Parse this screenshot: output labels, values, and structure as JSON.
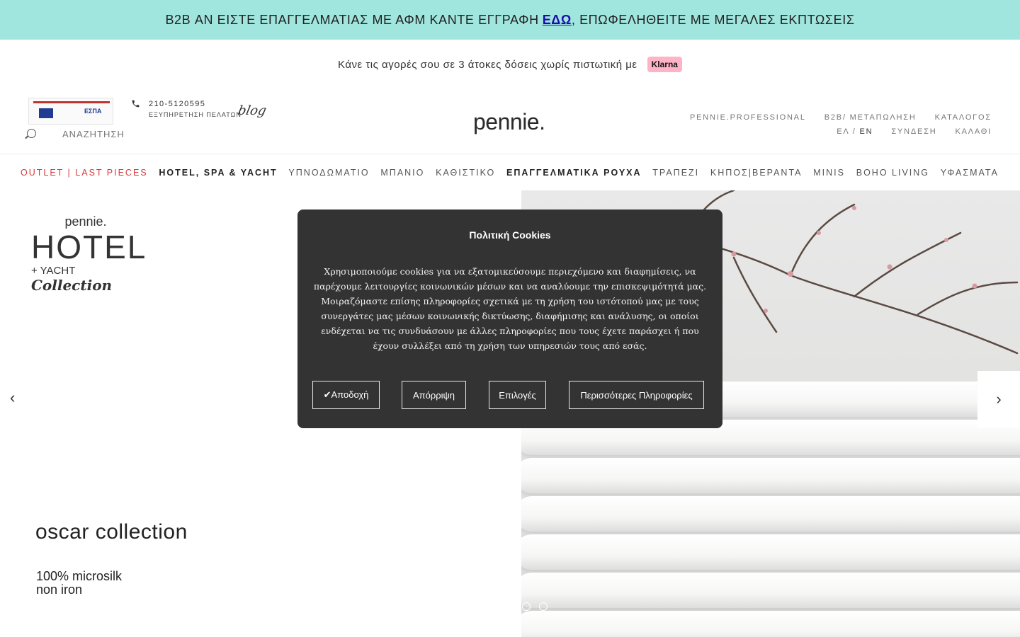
{
  "topbar": {
    "text_before": "B2B ΑΝ ΕΙΣΤΕ ΕΠΑΓΓΕΛΜΑΤΙΑΣ ΜΕ ΑΦΜ ΚΑΝΤΕ ΕΓΓΡΑΦΗ ",
    "link": "ΕΔΩ",
    "text_after": ", ΕΠΩΦΕΛΗΘΕΙΤΕ ΜΕ ΜΕΓΑΛΕΣ ΕΚΠΤΩΣΕΙΣ",
    "bg_color": "#a0e6de"
  },
  "klarna": {
    "text": "Κάνε τις αγορές σου σε 3 άτοκες δόσεις χωρίς πιστωτική με",
    "badge": "Klarna"
  },
  "header": {
    "espa_text": "ΕΣΠΑ",
    "phone": "210-5120595",
    "phone_sub": "ΕΞΥΠΗΡΕΤΗΣΗ ΠΕΛΑΤΩΝ",
    "blog": "blog",
    "search_placeholder": "ΑΝΑΖΗΤΗΣΗ",
    "logo": "pennie.",
    "right_row1": [
      "PENNIE.PROFESSIONAL",
      "B2B/ ΜΕΤΑΠΩΛΗΣΗ",
      "ΚΑΤΑΛΟΓΟΣ"
    ],
    "lang_el": "ΕΛ",
    "lang_sep": "/",
    "lang_en": "EN",
    "login": "ΣΥΝΔΕΣΗ",
    "cart": "ΚΑΛΑΘΙ"
  },
  "nav": [
    {
      "label": "OUTLET | LAST PIECES"
    },
    {
      "label": "HOTEL, SPA & YACHT"
    },
    {
      "label": "ΥΠΝΟΔΩΜΑΤΙΟ"
    },
    {
      "label": "ΜΠΑΝΙΟ"
    },
    {
      "label": "ΚΑΘΙΣΤΙΚΟ"
    },
    {
      "label": "ΕΠΑΓΓΕΛΜΑΤΙΚΑ ΡΟΥΧΑ"
    },
    {
      "label": "ΤΡΑΠΕΖΙ"
    },
    {
      "label": "ΚΗΠΟΣ|ΒΕΡΑΝΤΑ"
    },
    {
      "label": "MINIS"
    },
    {
      "label": "BOHO LIVING"
    },
    {
      "label": "ΥΦΑΣΜΑΤΑ"
    }
  ],
  "hero": {
    "logo_pennie": "pennie.",
    "logo_hotel": "HOTEL",
    "logo_yacht": "+ YACHT",
    "logo_collection": "Collection",
    "title": "oscar collection",
    "sub1": "100% microsilk",
    "sub2": "non iron",
    "arrow_left": "‹",
    "arrow_right": "›",
    "slide_count": 2
  },
  "cookies": {
    "title": "Πολιτική Cookies",
    "body": "Χρησιμοποιούμε cookies για να εξατομικεύσουμε περιεχόμενο και διαφημίσεις, να παρέχουμε λειτουργίες κοινωνικών μέσων και να αναλύουμε την επισκεψιμότητά μας. Μοιραζόμαστε επίσης πληροφορίες σχετικά με τη χρήση του ιστότοπού μας με τους συνεργάτες μας μέσων κοινωνικής δικτύωσης, διαφήμισης και ανάλυσης, οι οποίοι ενδέχεται να τις συνδυάσουν με άλλες πληροφορίες που τους έχετε παράσχει ή που έχουν συλλέξει από τη χρήση των υπηρεσιών τους από εσάς.",
    "accept": "✔Αποδοχή",
    "reject": "Απόρριψη",
    "options": "Επιλογές",
    "more": "Περισσότερες Πληροφορίες"
  }
}
